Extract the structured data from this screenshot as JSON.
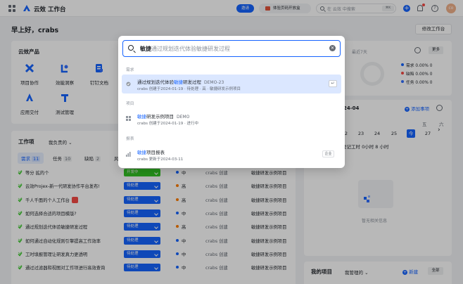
{
  "topbar": {
    "brand": "云效 工作台",
    "invite": "邀请",
    "trial": "体验页码开放盒",
    "search_placeholder": "在 云效 中搜索",
    "shortcut": "⌘K",
    "avatar_text": "co",
    "accent": "#1664ff"
  },
  "greeting": "早上好，crabs",
  "edit_workspace": "修改工作台",
  "products": {
    "title": "云效产品",
    "items": [
      {
        "label": "项目协作",
        "icon": "x-icon"
      },
      {
        "label": "效能洞察",
        "icon": "insight-icon"
      },
      {
        "label": "钉钉文档",
        "icon": "doc-icon"
      },
      {
        "label": "应用交付",
        "icon": "delivery-icon"
      },
      {
        "label": "测试管理",
        "icon": "test-icon"
      }
    ]
  },
  "stats": {
    "period": "最近7天",
    "more": "更多",
    "legend": [
      {
        "label": "需求 0.00% 0",
        "color": "#1664ff"
      },
      {
        "label": "缺陷 0.00% 0",
        "color": "#f54a45"
      },
      {
        "label": "任务 0.00% 0",
        "color": "#3370ff"
      }
    ]
  },
  "calendar": {
    "month": "24-04",
    "add_todo": "添加事项",
    "weekdays": [
      "五",
      "六"
    ],
    "days": [
      "2",
      "23",
      "24",
      "25",
      "今",
      "27"
    ],
    "today_label": "今",
    "log_hint": "登记工时 0小时 8 小时",
    "empty": "暂无相关信息"
  },
  "workitems": {
    "title": "工作项",
    "filter": "我负责的",
    "tabs": [
      {
        "label": "需求",
        "count": "11"
      },
      {
        "label": "任务",
        "count": "10"
      },
      {
        "label": "缺陷",
        "count": "2"
      },
      {
        "label": "风",
        "count": ""
      }
    ],
    "rows": [
      {
        "title": "等分 拡的个",
        "status": "开发中",
        "status_type": "prog",
        "priority": "中",
        "prio_color": "#1664ff",
        "owner": "crabs 创建",
        "project": "敏捷研发示例项目",
        "flag": false
      },
      {
        "title": "云效Projex-新一代研发协作平台发布!",
        "status": "待处理",
        "status_type": "todo",
        "priority": "高",
        "prio_color": "#ff7d00",
        "owner": "crabs 创建",
        "project": "敏捷研发示例项目",
        "flag": false
      },
      {
        "title": "千人千面的个人工作台",
        "status": "待处理",
        "status_type": "todo",
        "priority": "高",
        "prio_color": "#ff7d00",
        "owner": "crabs 创建",
        "project": "敏捷研发示例项目",
        "flag": true
      },
      {
        "title": "如何选择合适的项目模版?",
        "status": "待处理",
        "status_type": "todo",
        "priority": "中",
        "prio_color": "#1664ff",
        "owner": "crabs 创建",
        "project": "敏捷研发示例项目",
        "flag": false
      },
      {
        "title": "通过规划迭代体验敏捷研发过程",
        "status": "待处理",
        "status_type": "todo",
        "priority": "高",
        "prio_color": "#ff7d00",
        "owner": "crabs 创建",
        "project": "敏捷研发示例项目",
        "flag": false
      },
      {
        "title": "如何通过自动化规则引擎提高工作效率",
        "status": "待处理",
        "status_type": "todo",
        "priority": "中",
        "prio_color": "#1664ff",
        "owner": "crabs 创建",
        "project": "敏捷研发示例项目",
        "flag": false
      },
      {
        "title": "工时填报管理让研发真力更透明",
        "status": "待处理",
        "status_type": "todo",
        "priority": "中",
        "prio_color": "#1664ff",
        "owner": "crabs 创建",
        "project": "敏捷研发示例项目",
        "flag": false
      },
      {
        "title": "通过过滤器和视图对工作项进行高效查询",
        "status": "待处理",
        "status_type": "todo",
        "priority": "中",
        "prio_color": "#1664ff",
        "owner": "crabs 创建",
        "project": "敏捷研发示例项目",
        "flag": false
      }
    ]
  },
  "my_projects": {
    "title": "我的项目",
    "filter": "我管理的",
    "new": "新建",
    "all": "全部"
  },
  "search_modal": {
    "query_typed": "敏捷",
    "query_suggestion": "通过规划迭代体验敏捷研发过程",
    "sections": [
      {
        "header": "需求",
        "results": [
          {
            "pre": "通过规划迭代体验",
            "hit": "敏捷",
            "post": "研发过程",
            "code": "DEMO-23",
            "meta": "crabs 创建于2024-01-19 · 待处理 · 高 · 敏捷研发示例项目",
            "highlight": true,
            "action": "↵",
            "action_type": "enter"
          }
        ]
      },
      {
        "header": "项目",
        "results": [
          {
            "pre": "",
            "hit": "敏捷",
            "post": "研发示例项目",
            "code": "DEMO",
            "meta": "crabs 创建于2024-01-19 · 进行中",
            "highlight": false,
            "action": "",
            "action_type": ""
          }
        ]
      },
      {
        "header": "报表",
        "results": [
          {
            "pre": "",
            "hit": "敏捷",
            "post": "项目报表",
            "code": "",
            "meta": "crabs 更新于2024-03-11",
            "highlight": false,
            "action": "企业",
            "action_type": "tag"
          }
        ]
      }
    ]
  }
}
